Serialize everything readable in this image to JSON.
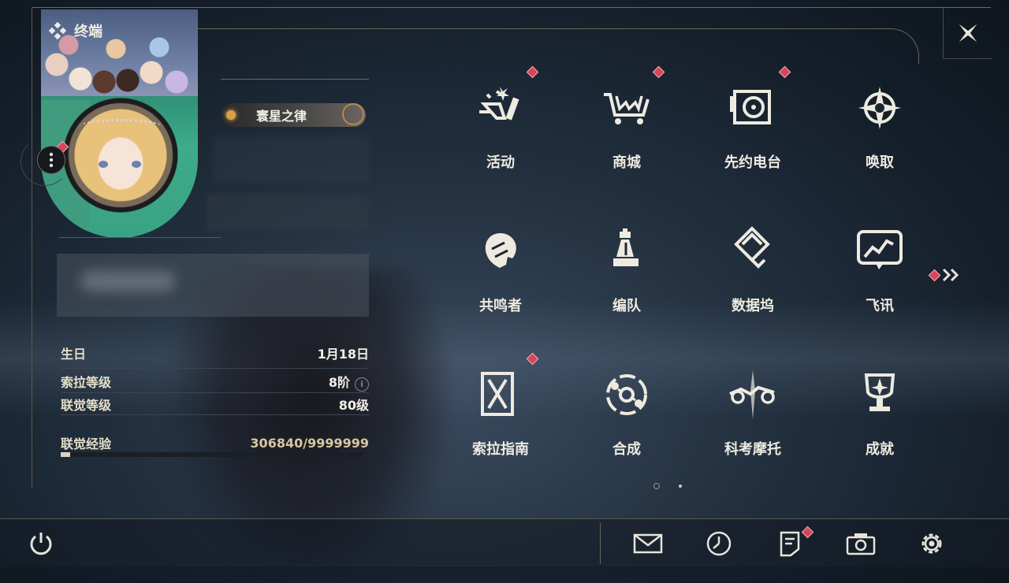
{
  "window": {
    "title": "终端"
  },
  "profile": {
    "title_badge": "寰星之律",
    "fields": [
      {
        "label": "生日",
        "value": "1月18日"
      },
      {
        "label": "索拉等级",
        "value": "8阶"
      },
      {
        "label": "联觉等级",
        "value": "80级"
      }
    ],
    "exp": {
      "label": "联觉经验",
      "value": "306840/9999999",
      "progress": 0.0307
    }
  },
  "menu": {
    "items": [
      {
        "label": "活动",
        "icon": "activity-icon",
        "badge": true
      },
      {
        "label": "商城",
        "icon": "shop-cart-icon",
        "badge": true
      },
      {
        "label": "先约电台",
        "icon": "radio-icon",
        "badge": true
      },
      {
        "label": "唤取",
        "icon": "compass-star-icon",
        "badge": false
      },
      {
        "label": "共鸣者",
        "icon": "resonator-icon",
        "badge": false
      },
      {
        "label": "编队",
        "icon": "chess-team-icon",
        "badge": false
      },
      {
        "label": "数据坞",
        "icon": "data-dock-icon",
        "badge": false
      },
      {
        "label": "飞讯",
        "icon": "message-icon",
        "badge": false
      },
      {
        "label": "索拉指南",
        "icon": "guide-book-icon",
        "badge": true
      },
      {
        "label": "合成",
        "icon": "synthesis-icon",
        "badge": false
      },
      {
        "label": "科考摩托",
        "icon": "motorcycle-icon",
        "badge": false
      },
      {
        "label": "成就",
        "icon": "trophy-icon",
        "badge": false
      }
    ],
    "page": {
      "current": 1,
      "total": 2
    }
  },
  "bottom": {
    "buttons": [
      "power-icon",
      "mail-icon",
      "clock-icon",
      "notice-icon",
      "camera-icon",
      "settings-icon"
    ]
  },
  "colors": {
    "badge": "#d8445a",
    "accent_gold": "#d8c8a0",
    "text": "#eeeae0"
  }
}
